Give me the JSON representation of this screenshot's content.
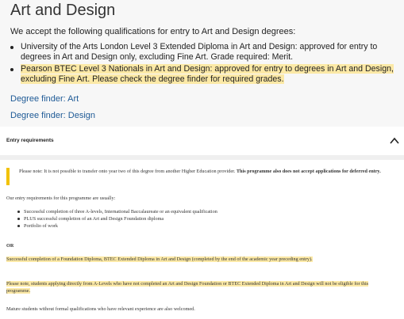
{
  "page": {
    "title": "Art and Design",
    "intro": "We accept the following qualifications for entry to Art and Design degrees:",
    "qualifications": [
      {
        "text": "University of the Arts London Level 3 Extended Diploma in Art and Design: approved for entry to degrees in Art and Design only, excluding Fine Art. Grade required: Merit.",
        "highlighted": false
      },
      {
        "text": "Pearson BTEC Level 3 Nationals in Art and Design: approved for entry to degrees in Art and Design, excluding Fine Art. Please check the degree finder for required grades.",
        "highlighted": true
      }
    ],
    "links": [
      "Degree finder: Art",
      "Degree finder: Design"
    ]
  },
  "entry_requirements": {
    "title": "Entry requirements",
    "notice_plain": "Please note: It is not possible to transfer onto year two of this degree from another Higher Education provider. ",
    "notice_bold": "This programme also does not accept applications for deferred entry.",
    "usually": "Our entry requirements for this programme are usually:",
    "requirements": [
      "Successful completion of three A-levels, International Baccalaureate or an equivalent qualification",
      "PLUS successful completion of an Art and Design Foundation diploma",
      "Portfolio of work"
    ],
    "or_label": "OR",
    "foundation": "Successful completion of a Foundation Diploma, BTEC Extended Diploma in Art and Design (completed by the end of the academic year preceding entry).",
    "direct_note": "Please note, students applying directly from A-Levels who have not completed an Art and Design Foundation or BTEC Extended Diploma in Art and Design will not be eligible for this programme.",
    "mature": "Mature students without formal qualifications who have relevant experience are also welcomed."
  },
  "colors": {
    "highlight": "#fce9a6",
    "link": "#1e5a96",
    "notice_bar": "#f2c200"
  },
  "icons": {
    "toggle": "chevron-up-icon"
  }
}
